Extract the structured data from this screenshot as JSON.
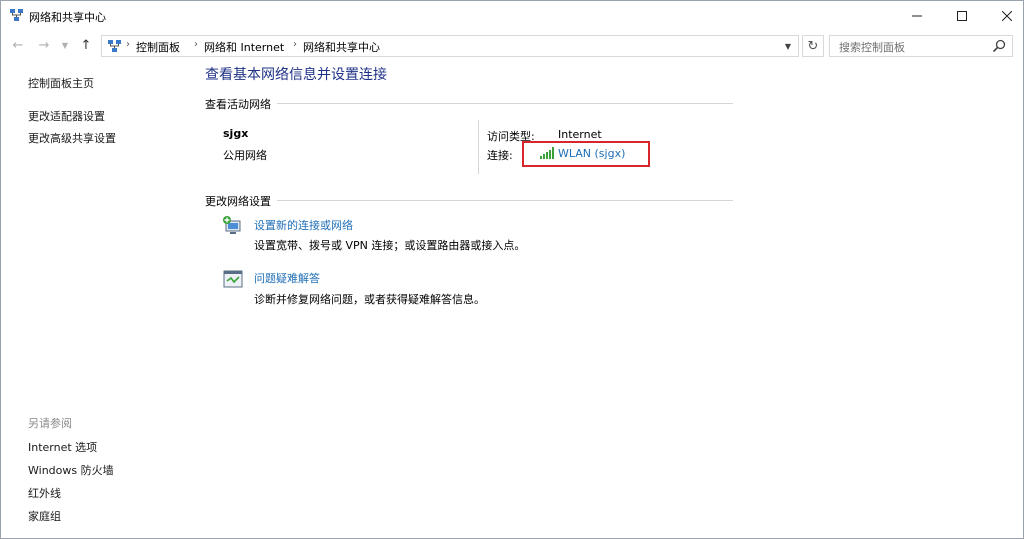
{
  "window": {
    "title": "网络和共享中心"
  },
  "nav": {
    "breadcrumbs": [
      "控制面板",
      "网络和 Internet",
      "网络和共享中心"
    ],
    "search_placeholder": "搜索控制面板"
  },
  "left_pane": {
    "links": [
      "控制面板主页",
      "更改适配器设置",
      "更改高级共享设置"
    ],
    "see_also_label": "另请参阅",
    "see_also_links": [
      "Internet 选项",
      "Windows 防火墙",
      "红外线",
      "家庭组"
    ]
  },
  "main": {
    "title": "查看基本网络信息并设置连接",
    "active_networks_label": "查看活动网络",
    "network": {
      "name": "sjgx",
      "type": "公用网络",
      "access_type_label": "访问类型:",
      "access_type_value": "Internet",
      "connection_label": "连接:",
      "connection_value": "WLAN (sjgx)"
    },
    "change_settings_label": "更改网络设置",
    "tasks": [
      {
        "link": "设置新的连接或网络",
        "description": "设置宽带、拨号或 VPN 连接；或设置路由器或接入点。",
        "icon": "new-connection-icon"
      },
      {
        "link": "问题疑难解答",
        "description": "诊断并修复网络问题，或者获得疑难解答信息。",
        "icon": "troubleshoot-icon"
      }
    ]
  },
  "colors": {
    "link": "#1f6fb7",
    "title": "#1e3287",
    "highlight": "#d9262c"
  }
}
